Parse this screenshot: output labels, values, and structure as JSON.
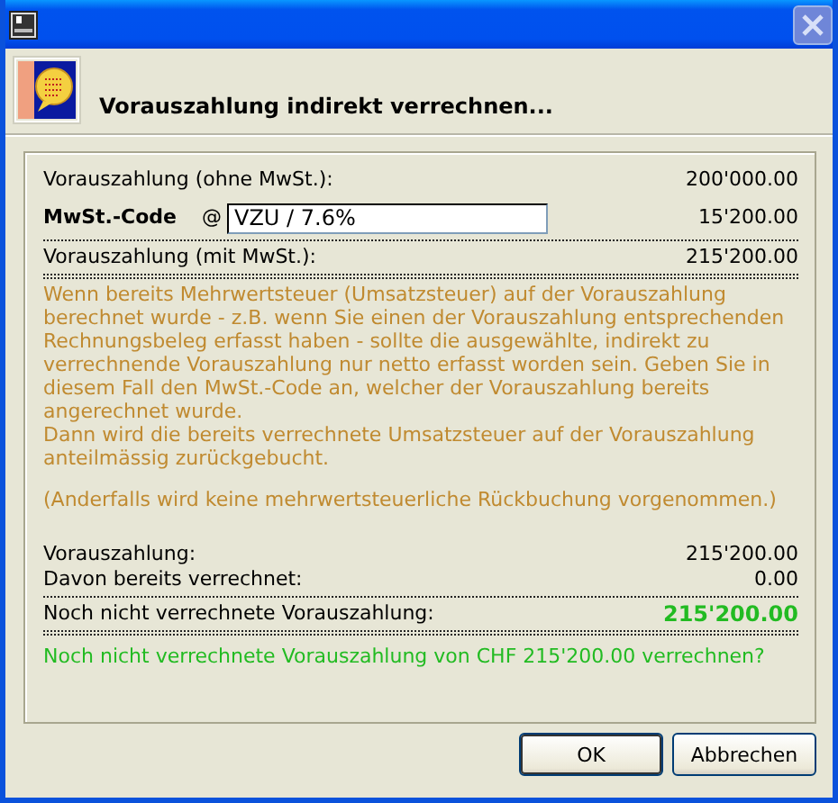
{
  "window": {
    "close_button": {
      "disabled": true
    }
  },
  "header": {
    "title": "Vorauszahlung indirekt verrechnen..."
  },
  "summary": [
    {
      "kind": "amount",
      "label": "Vorauszahlung (ohne MwSt.):",
      "value": "200'000.00"
    },
    {
      "kind": "code",
      "label": "MwSt.-Code",
      "at": "@",
      "input": "VZU / 7.6%",
      "value": "15'200.00"
    },
    {
      "kind": "total",
      "label": "Vorauszahlung (mit MwSt.):",
      "value": "215'200.00"
    }
  ],
  "explanation": [
    {
      "kind": "text",
      "text": "Wenn bereits Mehrwertsteuer (Umsatzsteuer) auf der Vorauszahlung berechnet wurde - z.B. wenn Sie einen der Vorauszahlung entsprechenden Rechnungsbeleg erfasst haben - sollte die ausgewählte, indirekt zu verrechnende Vorauszahlung nur netto erfasst worden sein. Geben Sie in diesem Fall den MwSt.-Code an, welcher der Vorauszahlung bereits angerechnet wurde."
    },
    {
      "kind": "text",
      "text": "Dann wird die bereits verrechnete Umsatzsteuer auf der Vorauszahlung anteilmässig zurückgebucht."
    },
    {
      "kind": "note",
      "text": "(Anderfalls wird keine mehrwertsteuerliche Rückbuchung vorgenommen.)"
    }
  ],
  "balance": [
    {
      "kind": "amount",
      "label": "Vorauszahlung:",
      "value": "215'200.00"
    },
    {
      "kind": "amount",
      "label": "Davon bereits verrechnet:",
      "value": "0.00"
    },
    {
      "kind": "highlight",
      "label": "Noch nicht verrechnete Vorauszahlung:",
      "value": "215'200.00"
    }
  ],
  "question": "Noch nicht verrechnete Vorauszahlung von CHF 215'200.00 verrechnen?",
  "buttons": [
    {
      "label": "OK",
      "default": true
    },
    {
      "label": "Abbrechen",
      "default": false
    }
  ]
}
